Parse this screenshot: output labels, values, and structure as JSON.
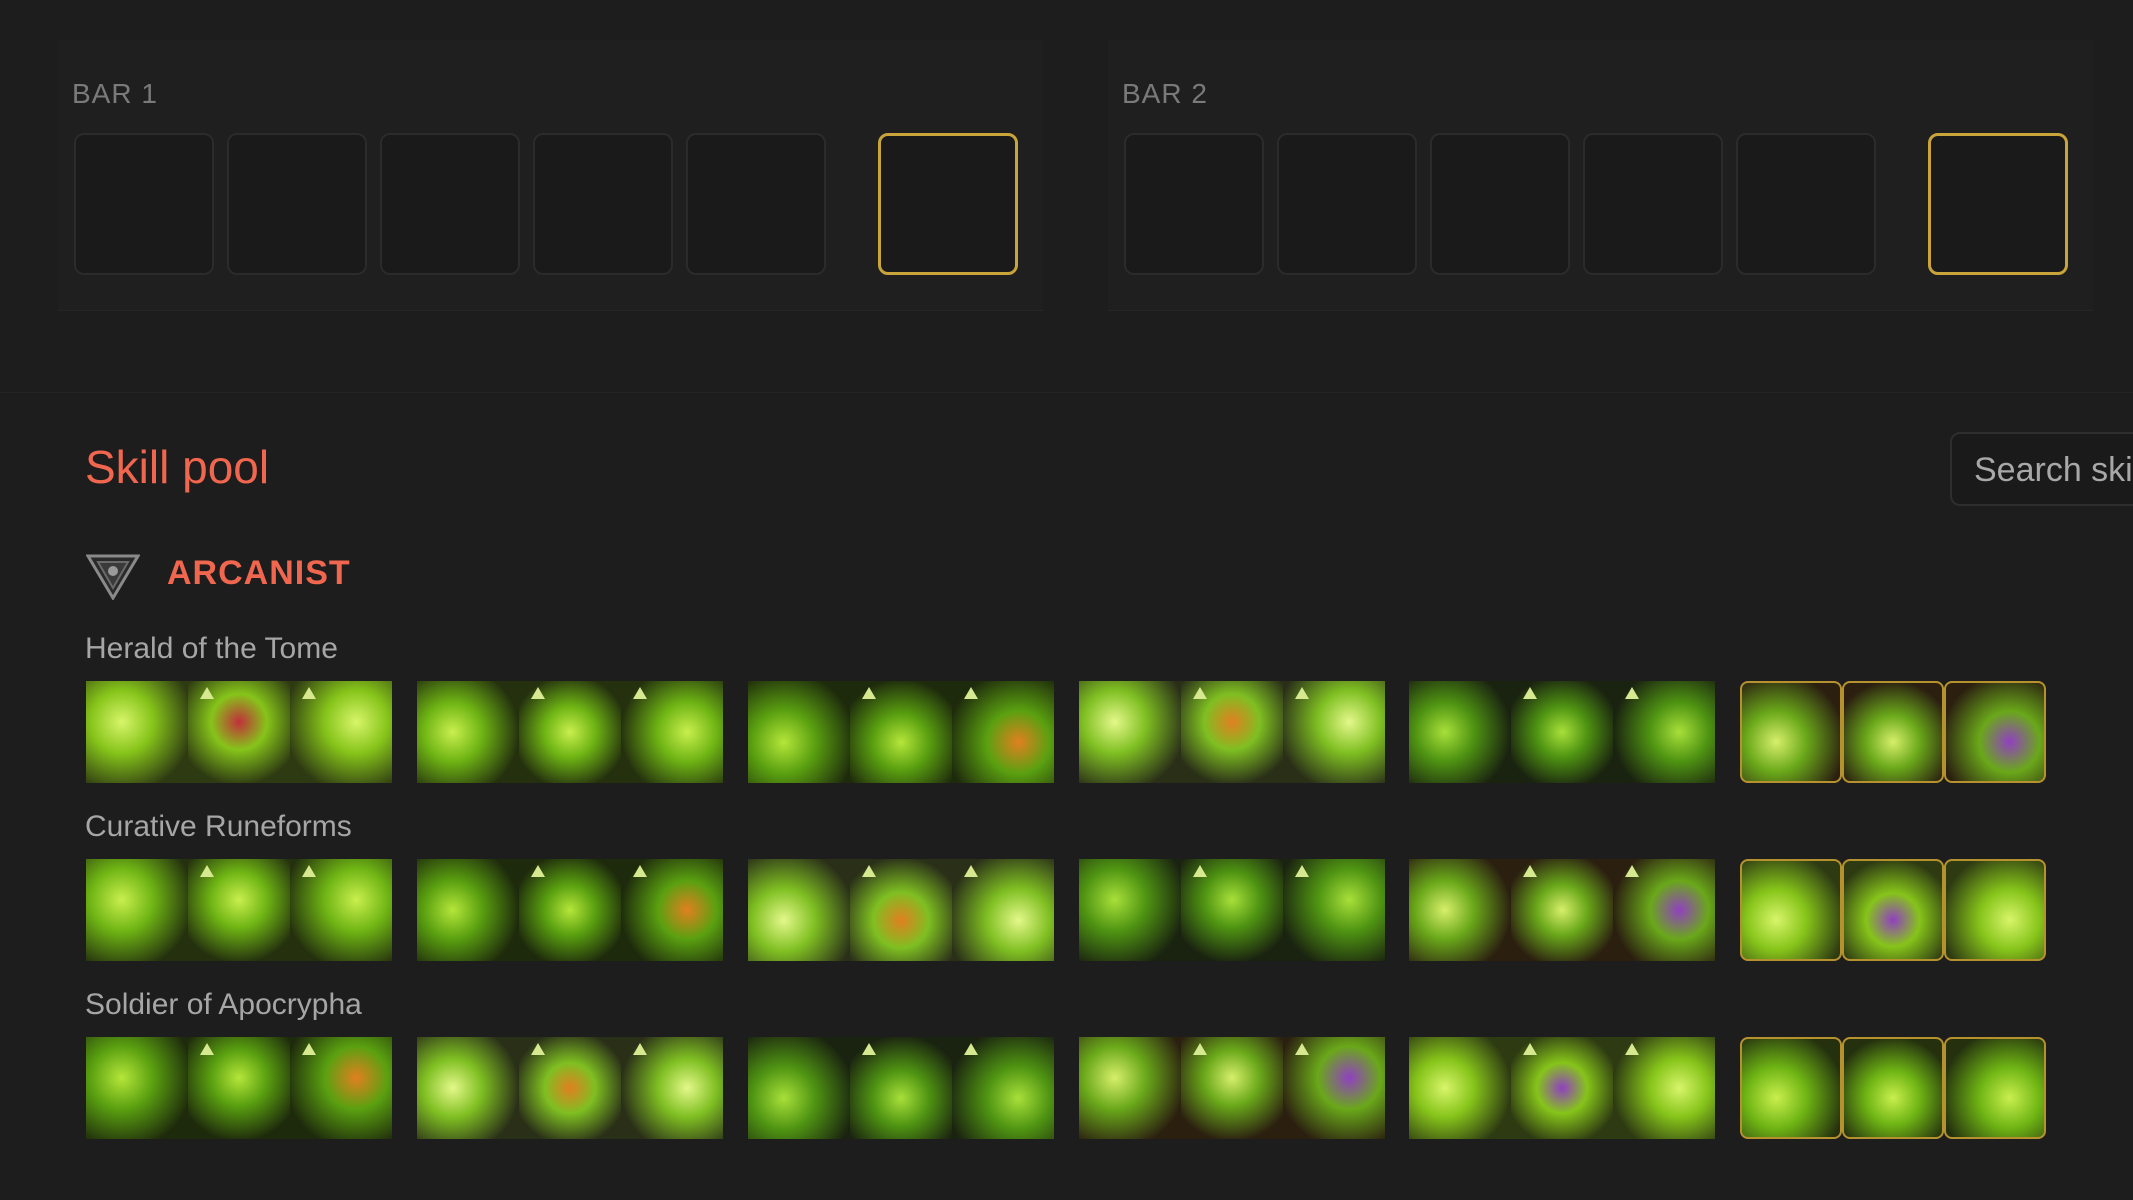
{
  "bars": [
    {
      "title": "BAR 1",
      "slots": 6
    },
    {
      "title": "BAR 2",
      "slots": 6
    }
  ],
  "skill_pool": {
    "title": "Skill pool",
    "search_placeholder": "Search skills",
    "class": {
      "name": "ARCANIST",
      "icon": "arcanist-emblem-icon",
      "accent_color": "#f0664e",
      "skill_lines": [
        {
          "name": "Herald of the Tome"
        },
        {
          "name": "Curative Runeforms"
        },
        {
          "name": "Soldier of Apocrypha"
        }
      ]
    }
  },
  "colors": {
    "background": "#1d1d1d",
    "ultimate_border": "#c9a43a",
    "skill_green": "#8fd61f"
  }
}
